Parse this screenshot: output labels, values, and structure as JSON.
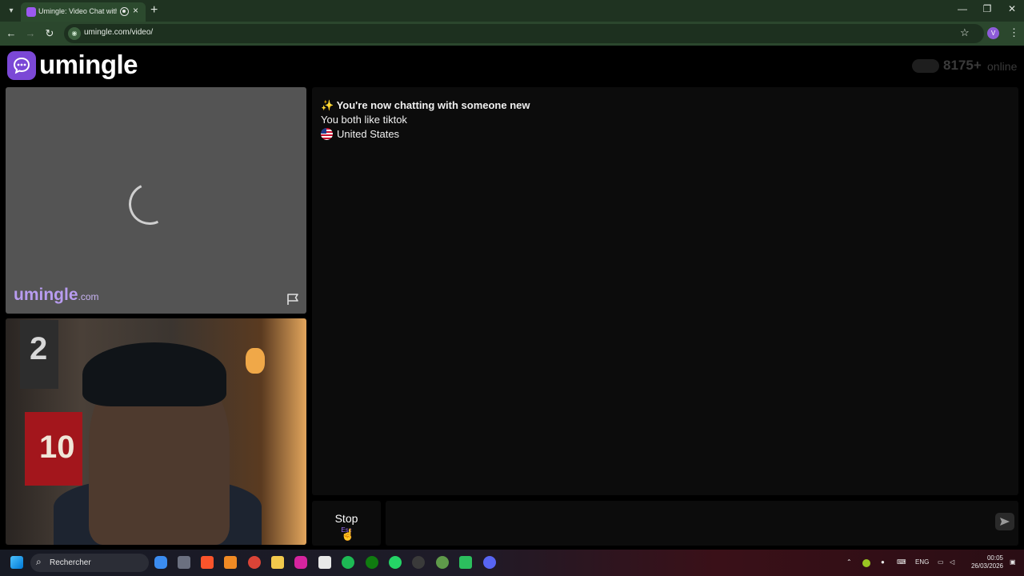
{
  "browser": {
    "tab_title": "Umingle: Video Chat with S",
    "url": "umingle.com/video/",
    "profile_initial": "V",
    "new_tab_glyph": "+",
    "close_glyph": "×",
    "icons": [
      "tab-search-icon",
      "umingle-favicon",
      "recording-icon",
      "close-icon",
      "new-tab-icon",
      "minimize-icon",
      "restore-icon",
      "window-close-icon",
      "back-icon",
      "forward-icon",
      "reload-icon",
      "site-info-icon",
      "bookmark-star-icon",
      "profile-avatar",
      "menu-kebab-icon"
    ]
  },
  "header": {
    "logo_text": "umingle",
    "online_count": "8175+",
    "online_label": "online"
  },
  "stranger_video": {
    "watermark_brand": "umingle",
    "watermark_tld": ".com"
  },
  "self_video": {
    "jersey_top_number": "2",
    "jersey_bottom_number": "10"
  },
  "chat": {
    "title_emoji": "✨",
    "title": "You're now chatting with someone new",
    "interest": "You both like tiktok",
    "country": "United States"
  },
  "controls": {
    "stop_label": "Stop",
    "stop_key": "Esc"
  },
  "taskbar": {
    "search_placeholder": "Rechercher",
    "language": "ENG",
    "time": "00:05",
    "date": "26/03/2026"
  },
  "colors": {
    "brand_purple": "#7b48d6",
    "chrome_green": "#2b472d",
    "panel_bg": "#0c0c0c",
    "video_placeholder": "#545454"
  }
}
